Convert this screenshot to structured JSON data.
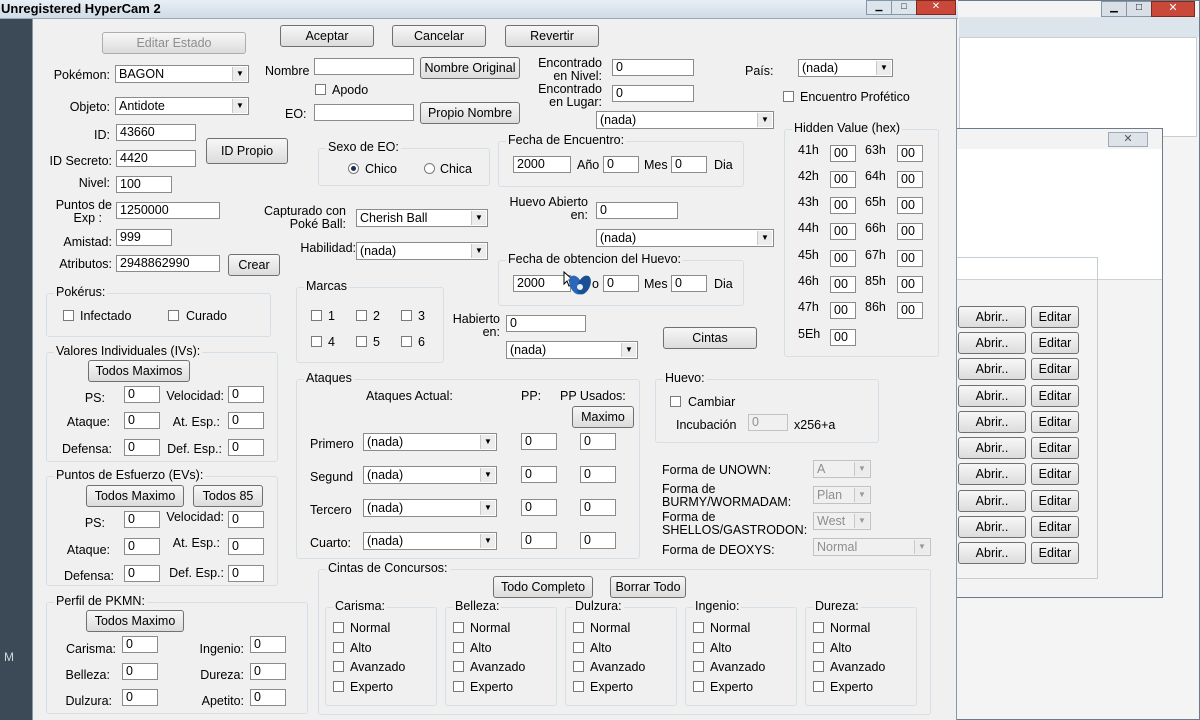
{
  "recording": {
    "title": "Unregistered HyperCam 2"
  },
  "left_edge_letter": "M",
  "dialog": {
    "top_buttons": {
      "editar_estado": "Editar Estado",
      "aceptar": "Aceptar",
      "cancelar": "Cancelar",
      "revertir": "Revertir"
    },
    "pokemon": {
      "label": "Pokémon:",
      "value": "BAGON"
    },
    "objeto": {
      "label": "Objeto:",
      "value": "Antidote"
    },
    "id": {
      "label": "ID:",
      "value": "43660"
    },
    "id_secreto": {
      "label": "ID Secreto:",
      "value": "4420"
    },
    "id_propio_button": "ID Propio",
    "nivel": {
      "label": "Nivel:",
      "value": "100"
    },
    "exp": {
      "label_1": "Puntos de",
      "label_2": "Exp :",
      "value": "1250000"
    },
    "amistad": {
      "label": "Amistad:",
      "value": "999"
    },
    "atributos": {
      "label": "Atributos:",
      "value": "2948862990",
      "button": "Crear"
    },
    "nombre": {
      "label": "Nombre",
      "value": "",
      "button": "Nombre Original"
    },
    "apodo": {
      "label": "Apodo"
    },
    "eo": {
      "label": "EO:",
      "value": "",
      "button": "Propio Nombre"
    },
    "encontrado_nivel": {
      "label_1": "Encontrado",
      "label_2": "en Nivel:",
      "value": "0"
    },
    "encontrado_lugar": {
      "label_1": "Encontrado",
      "label_2": "en Lugar:",
      "value": "0",
      "select": "(nada)"
    },
    "pais": {
      "label": "País:",
      "value": "(nada)"
    },
    "encuentro_profetico": "Encuentro Profético",
    "sexo_eo": {
      "title": "Sexo de EO:",
      "chico": "Chico",
      "chica": "Chica"
    },
    "fecha_encuentro": {
      "title": "Fecha de Encuentro:",
      "year": "2000",
      "year_label": "Año",
      "month": "0",
      "month_label": "Mes",
      "day": "0",
      "day_label": "Dia"
    },
    "capturado": {
      "label_1": "Capturado con",
      "label_2": "Poké Ball:",
      "value": "Cherish Ball"
    },
    "habilidad": {
      "label": "Habilidad:",
      "value": "(nada)"
    },
    "huevo_abierto": {
      "label_1": "Huevo Abierto",
      "label_2": "en:",
      "value": "0",
      "select": "(nada)"
    },
    "fecha_huevo": {
      "title": "Fecha de obtencion del Huevo:",
      "year": "2000",
      "year_label": "o",
      "month": "0",
      "month_label": "Mes",
      "day": "0",
      "day_label": "Dia"
    },
    "habierto": {
      "label_1": "Habierto",
      "label_2": "en:",
      "value": "0",
      "select": "(nada)"
    },
    "cintas_button": "Cintas",
    "pokerus": {
      "title": "Pokérus:",
      "infectado": "Infectado",
      "curado": "Curado"
    },
    "marcas": {
      "title": "Marcas",
      "items": [
        "1",
        "2",
        "3",
        "4",
        "5",
        "6"
      ]
    },
    "ivs": {
      "title": "Valores Individuales (IVs):",
      "button": "Todos Maximos",
      "ps": {
        "label": "PS:",
        "value": "0"
      },
      "ataque": {
        "label": "Ataque:",
        "value": "0"
      },
      "defensa": {
        "label": "Defensa:",
        "value": "0"
      },
      "velocidad": {
        "label": "Velocidad:",
        "value": "0"
      },
      "at_esp": {
        "label": "At. Esp.:",
        "value": "0"
      },
      "def_esp": {
        "label": "Def. Esp.:",
        "value": "0"
      }
    },
    "evs": {
      "title": "Puntos de Esfuerzo (EVs):",
      "button": "Todos Maximo",
      "button2": "Todos 85",
      "ps": {
        "label": "PS:",
        "value": "0"
      },
      "ataque": {
        "label": "Ataque:",
        "value": "0"
      },
      "defensa": {
        "label": "Defensa:",
        "value": "0"
      },
      "velocidad": {
        "label": "Velocidad:",
        "value": "0"
      },
      "at_esp": {
        "label": "At. Esp.:",
        "value": "0"
      },
      "def_esp": {
        "label": "Def. Esp.:",
        "value": "0"
      }
    },
    "perfil": {
      "title": "Perfil de PKMN:",
      "button": "Todos Maximo",
      "carisma": {
        "label": "Carisma:",
        "value": "0"
      },
      "belleza": {
        "label": "Belleza:",
        "value": "0"
      },
      "dulzura": {
        "label": "Dulzura:",
        "value": "0"
      },
      "ingenio": {
        "label": "Ingenio:",
        "value": "0"
      },
      "dureza": {
        "label": "Dureza:",
        "value": "0"
      },
      "apetito": {
        "label": "Apetito:",
        "value": "0"
      }
    },
    "ataques": {
      "title": "Ataques",
      "col_actual": "Ataques Actual:",
      "col_pp": "PP:",
      "col_pp_usados": "PP Usados:",
      "maximo_button": "Maximo",
      "rows": [
        {
          "label": "Primero",
          "move": "(nada)",
          "pp": "0",
          "pp_used": "0"
        },
        {
          "label": "Segund",
          "move": "(nada)",
          "pp": "0",
          "pp_used": "0"
        },
        {
          "label": "Tercero",
          "move": "(nada)",
          "pp": "0",
          "pp_used": "0"
        },
        {
          "label": "Cuarto:",
          "move": "(nada)",
          "pp": "0",
          "pp_used": "0"
        }
      ]
    },
    "huevo": {
      "title": "Huevo:",
      "cambiar": "Cambiar",
      "incubacion_label": "Incubación",
      "incubacion_value": "0",
      "suffix": "x256+a"
    },
    "formas": {
      "unown": {
        "label": "Forma de UNOWN:",
        "value": "A"
      },
      "burmy_1": "Forma de",
      "burmy_2": "BURMY/WORMADAM:",
      "burmy_value": "Plan",
      "shellos_1": "Forma de",
      "shellos_2": "SHELLOS/GASTRODON:",
      "shellos_value": "West",
      "deoxys": {
        "label": "Forma de DEOXYS:",
        "value": "Normal"
      }
    },
    "hidden": {
      "title": "Hidden Value (hex)",
      "left": [
        {
          "label": "41h",
          "value": "00"
        },
        {
          "label": "42h",
          "value": "00"
        },
        {
          "label": "43h",
          "value": "00"
        },
        {
          "label": "44h",
          "value": "00"
        },
        {
          "label": "45h",
          "value": "00"
        },
        {
          "label": "46h",
          "value": "00"
        },
        {
          "label": "47h",
          "value": "00"
        },
        {
          "label": "5Eh",
          "value": "00"
        }
      ],
      "right": [
        {
          "label": "63h",
          "value": "00"
        },
        {
          "label": "64h",
          "value": "00"
        },
        {
          "label": "65h",
          "value": "00"
        },
        {
          "label": "66h",
          "value": "00"
        },
        {
          "label": "67h",
          "value": "00"
        },
        {
          "label": "85h",
          "value": "00"
        },
        {
          "label": "86h",
          "value": "00"
        }
      ]
    },
    "concursos": {
      "title": "Cintas de Concursos:",
      "todo_completo": "Todo Completo",
      "borrar_todo": "Borrar Todo",
      "groups": [
        {
          "title": "Carisma:",
          "items": [
            "Normal",
            "Alto",
            "Avanzado",
            "Experto"
          ]
        },
        {
          "title": "Belleza:",
          "items": [
            "Normal",
            "Alto",
            "Avanzado",
            "Experto"
          ]
        },
        {
          "title": "Dulzura:",
          "items": [
            "Normal",
            "Alto",
            "Avanzado",
            "Experto"
          ]
        },
        {
          "title": "Ingenio:",
          "items": [
            "Normal",
            "Alto",
            "Avanzado",
            "Experto"
          ]
        },
        {
          "title": "Dureza:",
          "items": [
            "Normal",
            "Alto",
            "Avanzado",
            "Experto"
          ]
        }
      ]
    }
  },
  "background_window": {
    "rows": [
      {
        "abrir": "Abrir..",
        "editar": "Editar"
      },
      {
        "abrir": "Abrir..",
        "editar": "Editar"
      },
      {
        "abrir": "Abrir..",
        "editar": "Editar"
      },
      {
        "abrir": "Abrir..",
        "editar": "Editar"
      },
      {
        "abrir": "Abrir..",
        "editar": "Editar"
      },
      {
        "abrir": "Abrir..",
        "editar": "Editar"
      },
      {
        "abrir": "Abrir..",
        "editar": "Editar"
      },
      {
        "abrir": "Abrir..",
        "editar": "Editar"
      },
      {
        "abrir": "Abrir..",
        "editar": "Editar"
      },
      {
        "abrir": "Abrir..",
        "editar": "Editar"
      }
    ]
  }
}
